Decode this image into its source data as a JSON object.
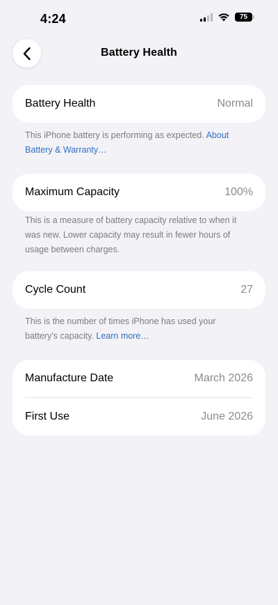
{
  "status_bar": {
    "time": "4:24",
    "battery_level": "75",
    "signal_bars_active": 2,
    "signal_bars_total": 4
  },
  "nav": {
    "title": "Battery Health",
    "back_icon": "chevron-left-icon"
  },
  "battery_health": {
    "label": "Battery Health",
    "value": "Normal",
    "footnote": "This iPhone battery is performing as expected.",
    "link": "About Battery & Warranty…"
  },
  "maximum_capacity": {
    "label": "Maximum Capacity",
    "value": "100%",
    "footnote": "This is a measure of battery capacity relative to when it was new. Lower capacity may result in fewer hours of usage between charges."
  },
  "cycle_count": {
    "label": "Cycle Count",
    "value": "27",
    "footnote": "This is the number of times iPhone has used your battery’s capacity.",
    "link": "Learn more…"
  },
  "dates": {
    "manufacture_label": "Manufacture Date",
    "manufacture_value": "March 2026",
    "first_use_label": "First Use",
    "first_use_value": "June 2026"
  },
  "colors": {
    "background": "#f2f2f7",
    "card": "#ffffff",
    "link": "#2f6fc2",
    "secondary_text": "#8a8a8e"
  }
}
